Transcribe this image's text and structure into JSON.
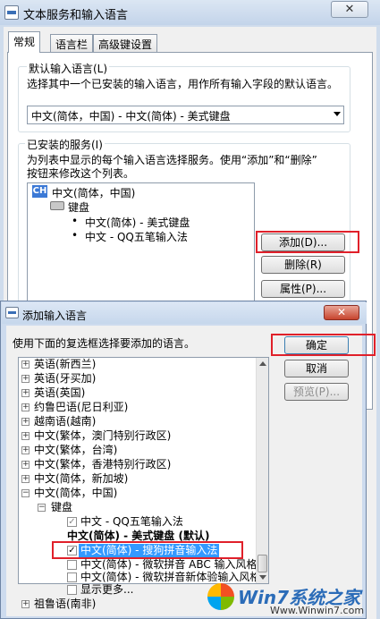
{
  "main_window": {
    "title": "文本服务和输入语言",
    "close": "✕",
    "tabs": [
      "常规",
      "语言栏",
      "高级键设置"
    ],
    "default_lang_label": "默认输入语言(L)",
    "default_lang_desc": "选择其中一个已安装的输入语言，用作所有输入字段的默认语言。",
    "default_lang_value": "中文(简体，中国) - 中文(简体) - 美式键盘",
    "installed_label": "已安装的服务(I)",
    "installed_desc_1": "为列表中显示的每个输入语言选择服务。使用“添加”和“删除”",
    "installed_desc_2": "按钮来修改这个列表。",
    "services": {
      "lang_badge": "CH",
      "lang": "中文(简体，中国)",
      "group": "键盘",
      "items": [
        "中文(简体) - 美式键盘",
        "中文 - QQ五笔输入法"
      ]
    },
    "buttons": {
      "add": "添加(D)...",
      "remove": "删除(R)",
      "properties": "属性(P)..."
    }
  },
  "dialog": {
    "title": "添加输入语言",
    "close": "✕",
    "instruction": "使用下面的复选框选择要添加的语言。",
    "buttons": {
      "ok": "确定",
      "cancel": "取消",
      "preview": "预览(P)..."
    },
    "tree": [
      "英语(新西兰)",
      "英语(牙买加)",
      "英语(英国)",
      "约鲁巴语(尼日利亚)",
      "越南语(越南)",
      "中文(繁体，澳门特别行政区)",
      "中文(繁体，台湾)",
      "中文(繁体，香港特别行政区)",
      "中文(简体，新加坡)",
      "中文(简体，中国)"
    ],
    "tree_group": "键盘",
    "tree_items": [
      "中文 - QQ五笔输入法",
      "中文(简体) - 美式键盘 (默认)",
      "中文(简体) - 搜狗拼音输入法",
      "中文(简体) - 微软拼音 ABC 输入风格",
      "中文(简体) - 微软拼音新体验输入风格",
      "显示更多..."
    ],
    "tree_last": "祖鲁语(南非)"
  },
  "watermark": {
    "brand": "Win7系统之家",
    "url": "Www.Winwin7.com"
  },
  "colors": {
    "highlight": "#e0202a",
    "selection": "#3399ff"
  }
}
